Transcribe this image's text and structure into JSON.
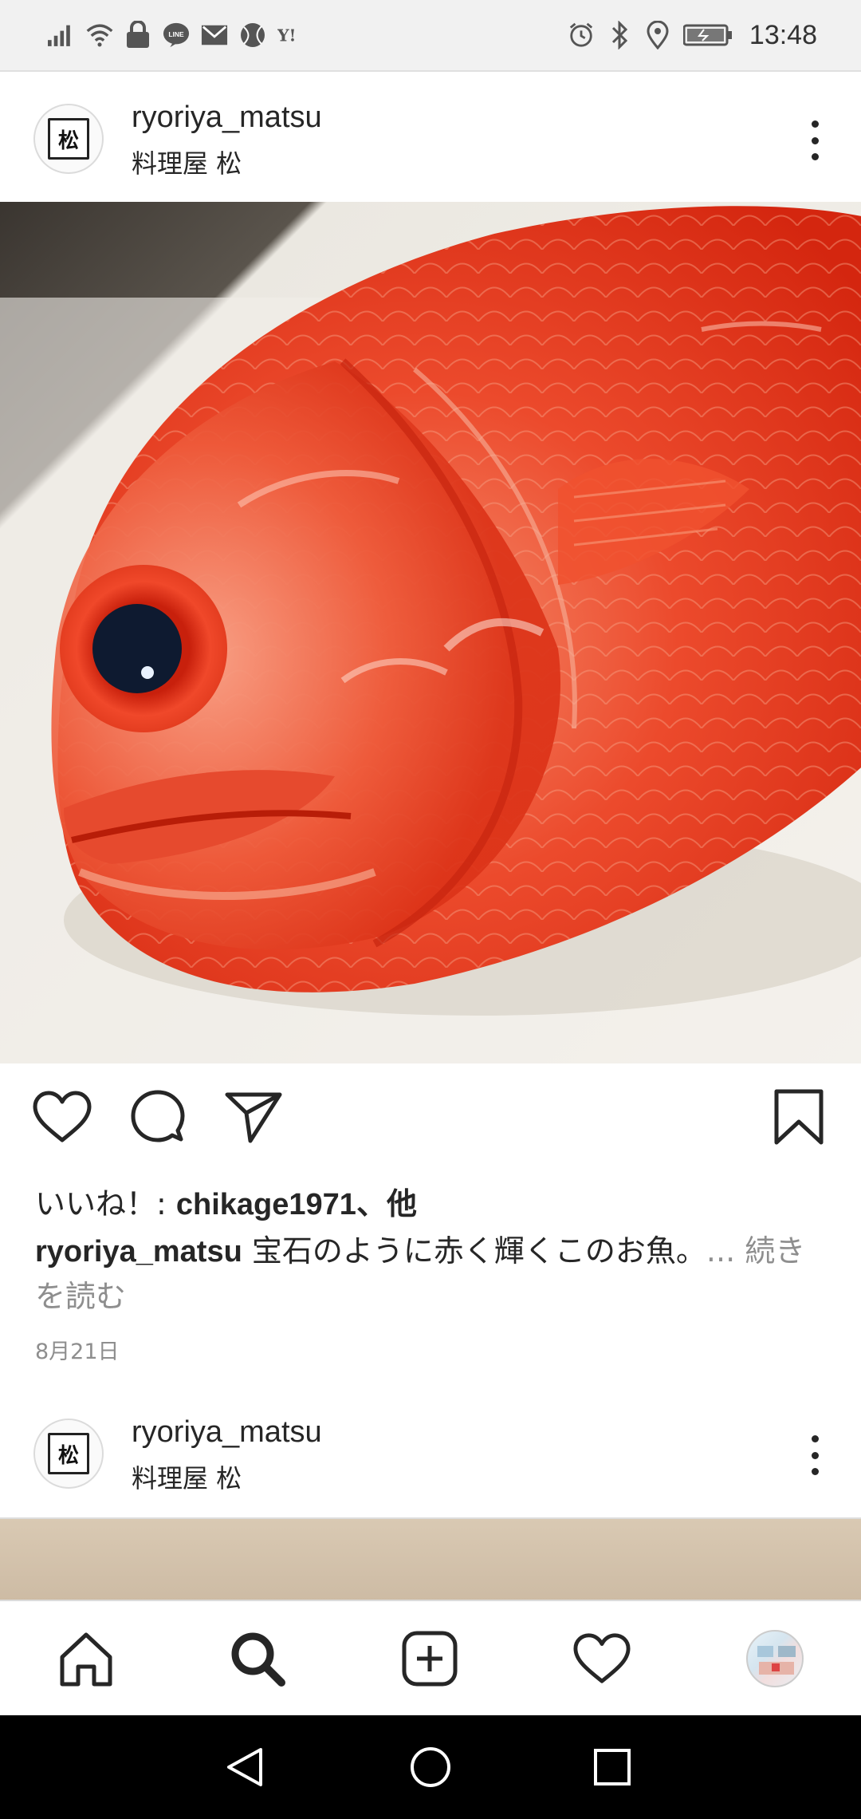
{
  "status_bar": {
    "time": "13:48",
    "left_icons": [
      "signal-icon",
      "wifi-icon",
      "vpn-lock-icon",
      "line-icon",
      "mail-icon",
      "ball-icon",
      "yahoo-icon"
    ],
    "right_icons": [
      "alarm-icon",
      "bluetooth-icon",
      "location-icon",
      "battery-icon"
    ]
  },
  "post1": {
    "username": "ryoriya_matsu",
    "subtitle": "料理屋 松",
    "avatar_text": "松",
    "likes_prefix": "いいね！: ",
    "likes_user": "chikage1971",
    "likes_suffix": "、他",
    "caption_user": "ryoriya_matsu",
    "caption_text": " 宝石のように赤く輝くこのお魚。",
    "caption_more": "... 続きを読む",
    "date": "8月21日"
  },
  "post2": {
    "username": "ryoriya_matsu",
    "subtitle": "料理屋 松",
    "avatar_text": "松"
  },
  "colors": {
    "fish_red": "#e8371f",
    "text": "#262626",
    "muted": "#8e8e8e"
  }
}
